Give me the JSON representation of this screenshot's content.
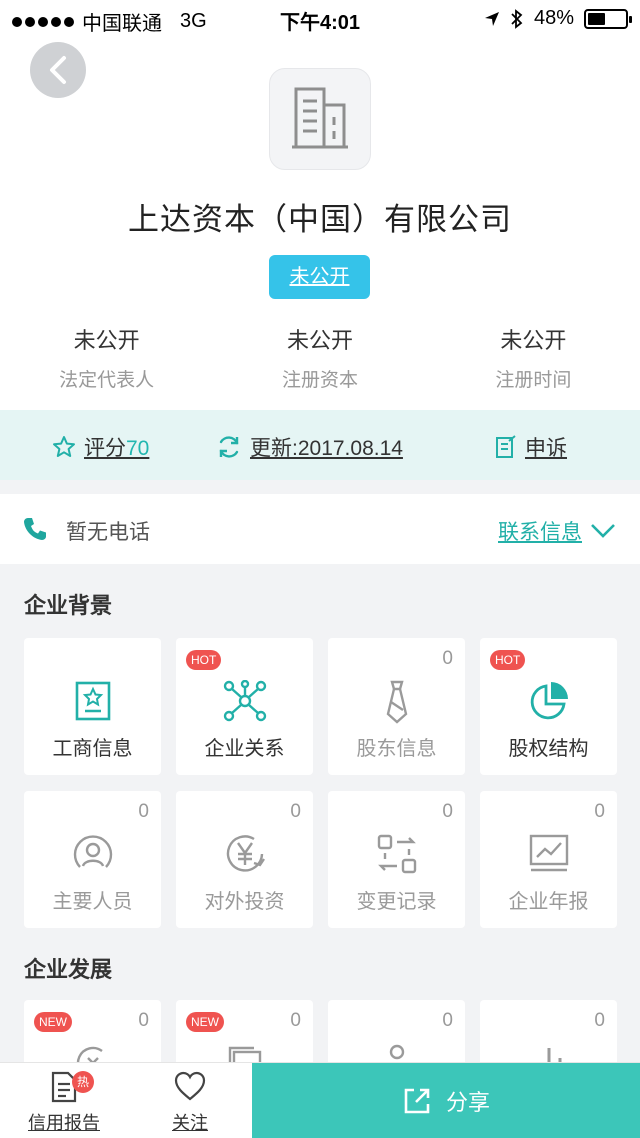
{
  "status_bar": {
    "carrier": "中国联通",
    "network": "3G",
    "time": "下午4:01",
    "battery": "48%",
    "battery_level": 0.48
  },
  "company": {
    "name": "上达资本（中国）有限公司",
    "status_tag": "未公开",
    "stats": [
      {
        "value": "未公开",
        "label": "法定代表人"
      },
      {
        "value": "未公开",
        "label": "注册资本"
      },
      {
        "value": "未公开",
        "label": "注册时间"
      }
    ]
  },
  "actions": {
    "score_label": "评分",
    "score_value": "70",
    "update_label": "更新:2017.08.14",
    "appeal_label": "申诉"
  },
  "contact": {
    "phone_text": "暂无电话",
    "contact_info_label": "联系信息"
  },
  "sections": {
    "background_title": "企业背景",
    "background_tiles": [
      {
        "label": "工商信息",
        "count": "",
        "badge": "",
        "icon": "badge-icon"
      },
      {
        "label": "企业关系",
        "count": "",
        "badge": "HOT",
        "icon": "network-icon"
      },
      {
        "label": "股东信息",
        "count": "0",
        "badge": "",
        "icon": "tie-icon"
      },
      {
        "label": "股权结构",
        "count": "",
        "badge": "HOT",
        "icon": "pie-chart-icon"
      },
      {
        "label": "主要人员",
        "count": "0",
        "badge": "",
        "icon": "person-icon"
      },
      {
        "label": "对外投资",
        "count": "0",
        "badge": "",
        "icon": "yen-icon"
      },
      {
        "label": "变更记录",
        "count": "0",
        "badge": "",
        "icon": "swap-icon"
      },
      {
        "label": "企业年报",
        "count": "0",
        "badge": "",
        "icon": "line-chart-icon"
      }
    ],
    "development_title": "企业发展",
    "development_tiles": [
      {
        "count": "0",
        "badge": "NEW"
      },
      {
        "count": "0",
        "badge": "NEW"
      },
      {
        "count": "0",
        "badge": ""
      },
      {
        "count": "0",
        "badge": ""
      }
    ]
  },
  "bottom_bar": {
    "report_label": "信用报告",
    "report_hot": "热",
    "follow_label": "关注",
    "share_label": "分享"
  },
  "colors": {
    "accent": "#22b0a8",
    "tag_blue": "#35c3e9",
    "hot_red": "#ef5350",
    "share_green": "#3cc6b9",
    "action_bar_bg": "#e5f5f4"
  }
}
